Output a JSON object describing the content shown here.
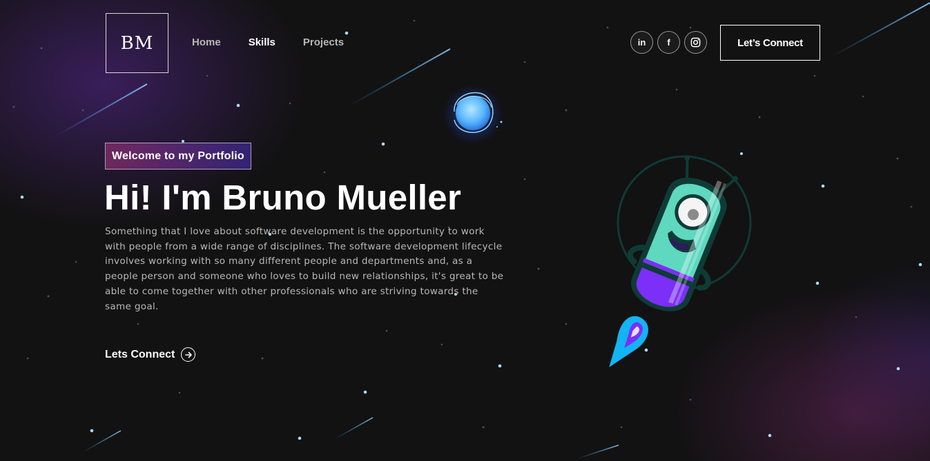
{
  "header": {
    "logo": "BM",
    "nav": [
      "Home",
      "Skills",
      "Projects"
    ],
    "socials": [
      {
        "name": "linkedin",
        "glyph": "in"
      },
      {
        "name": "facebook",
        "glyph": "f"
      },
      {
        "name": "instagram",
        "glyph": "◎"
      }
    ],
    "connect_button": "Let’s Connect"
  },
  "hero": {
    "tagline": "Welcome to my Portfolio",
    "title": "Hi! I'm Bruno Mueller",
    "description": "Something that I love about software development is the opportunity to work with people from a wide range of disciplines. The software development lifecycle involves working with so many different people and departments and, as a people person and someone who loves to build new relationships, it's great to be able to come together with other professionals who are striving towards the same goal.",
    "cta": "Lets Connect",
    "cta_icon": "arrow-right-circle-icon"
  },
  "colors": {
    "background": "#121212",
    "tag_gradient_start": "#aa367c",
    "tag_gradient_end": "#4a2fbd",
    "planet_blue": "#5ab8ff",
    "alien_teal": "#5fd8c0",
    "alien_purple": "#7b2ff7"
  }
}
